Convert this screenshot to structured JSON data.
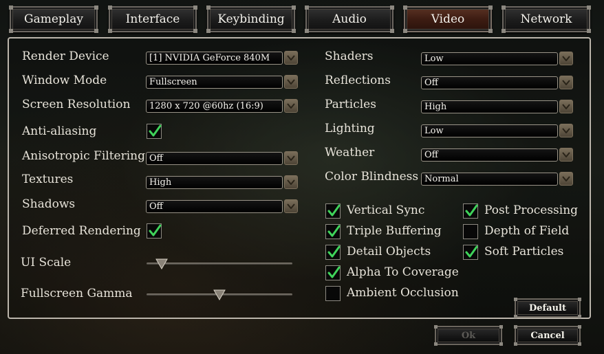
{
  "tabs": [
    "Gameplay",
    "Interface",
    "Keybinding",
    "Audio",
    "Video",
    "Network"
  ],
  "active_tab": "Video",
  "left_settings": {
    "render_device": {
      "label": "Render Device",
      "value": "[1] NVIDIA GeForce 840M"
    },
    "window_mode": {
      "label": "Window Mode",
      "value": "Fullscreen"
    },
    "screen_resolution": {
      "label": "Screen Resolution",
      "value": "1280 x 720 @60hz (16:9)"
    },
    "anti_aliasing": {
      "label": "Anti-aliasing",
      "checked": true
    },
    "anisotropic_filtering": {
      "label": "Anisotropic Filtering",
      "value": "Off"
    },
    "textures": {
      "label": "Textures",
      "value": "High"
    },
    "shadows": {
      "label": "Shadows",
      "value": "Off"
    },
    "deferred_rendering": {
      "label": "Deferred Rendering",
      "checked": true
    },
    "ui_scale": {
      "label": "UI Scale",
      "level": 0.06
    },
    "fullscreen_gamma": {
      "label": "Fullscreen Gamma",
      "level": 0.5
    }
  },
  "right_settings": {
    "shaders": {
      "label": "Shaders",
      "value": "Low"
    },
    "reflections": {
      "label": "Reflections",
      "value": "Off"
    },
    "particles": {
      "label": "Particles",
      "value": "High"
    },
    "lighting": {
      "label": "Lighting",
      "value": "Low"
    },
    "weather": {
      "label": "Weather",
      "value": "Off"
    },
    "color_blindness": {
      "label": "Color Blindness",
      "value": "Normal"
    }
  },
  "toggles": {
    "vertical_sync": {
      "label": "Vertical Sync",
      "checked": true
    },
    "triple_buffering": {
      "label": "Triple Buffering",
      "checked": true
    },
    "detail_objects": {
      "label": "Detail Objects",
      "checked": true
    },
    "alpha_to_coverage": {
      "label": "Alpha To Coverage",
      "checked": true
    },
    "ambient_occlusion": {
      "label": "Ambient Occlusion",
      "checked": false
    },
    "post_processing": {
      "label": "Post Processing",
      "checked": true
    },
    "depth_of_field": {
      "label": "Depth of Field",
      "checked": false
    },
    "soft_particles": {
      "label": "Soft Particles",
      "checked": true
    }
  },
  "buttons": {
    "default": "Default",
    "ok": "Ok",
    "cancel": "Cancel"
  },
  "colors": {
    "check": "#3fd35a",
    "active_tab": "#4a2418",
    "panel_border": "#bcb6ac"
  }
}
